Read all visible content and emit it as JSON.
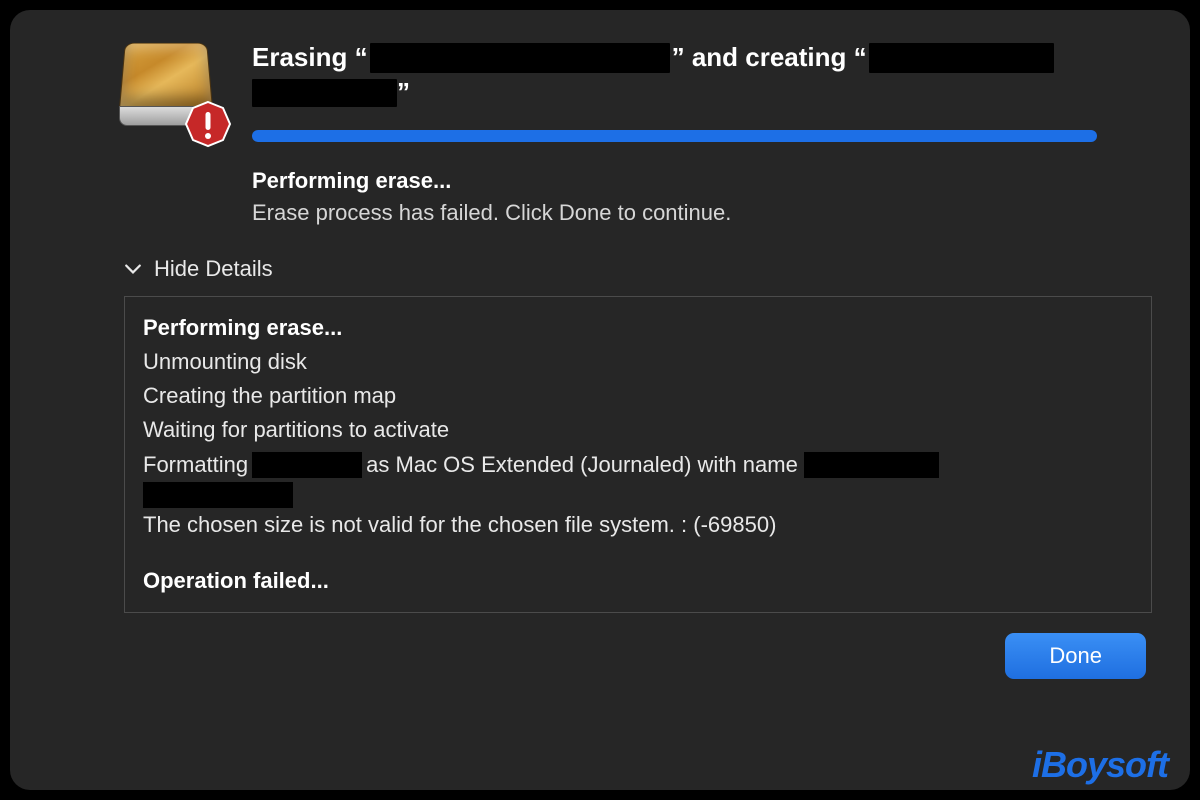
{
  "title": {
    "prefix": "Erasing “",
    "mid": "” and creating “",
    "suffix": "”"
  },
  "status": {
    "heading": "Performing erase...",
    "sub": "Erase process has failed. Click Done to continue."
  },
  "detailsToggleLabel": "Hide Details",
  "log": {
    "l0": "Performing erase...",
    "l1": "Unmounting disk",
    "l2": "Creating the partition map",
    "l3": "Waiting for partitions to activate",
    "l4a": "Formatting ",
    "l4b": " as Mac OS Extended (Journaled) with name ",
    "l5": "The chosen size is not valid for the chosen file system. : (-69850)",
    "l6": "Operation failed..."
  },
  "doneLabel": "Done",
  "watermark": "iBoysoft",
  "progressPercent": 100,
  "colors": {
    "accent": "#1d6fe6",
    "panel": "#262626"
  }
}
